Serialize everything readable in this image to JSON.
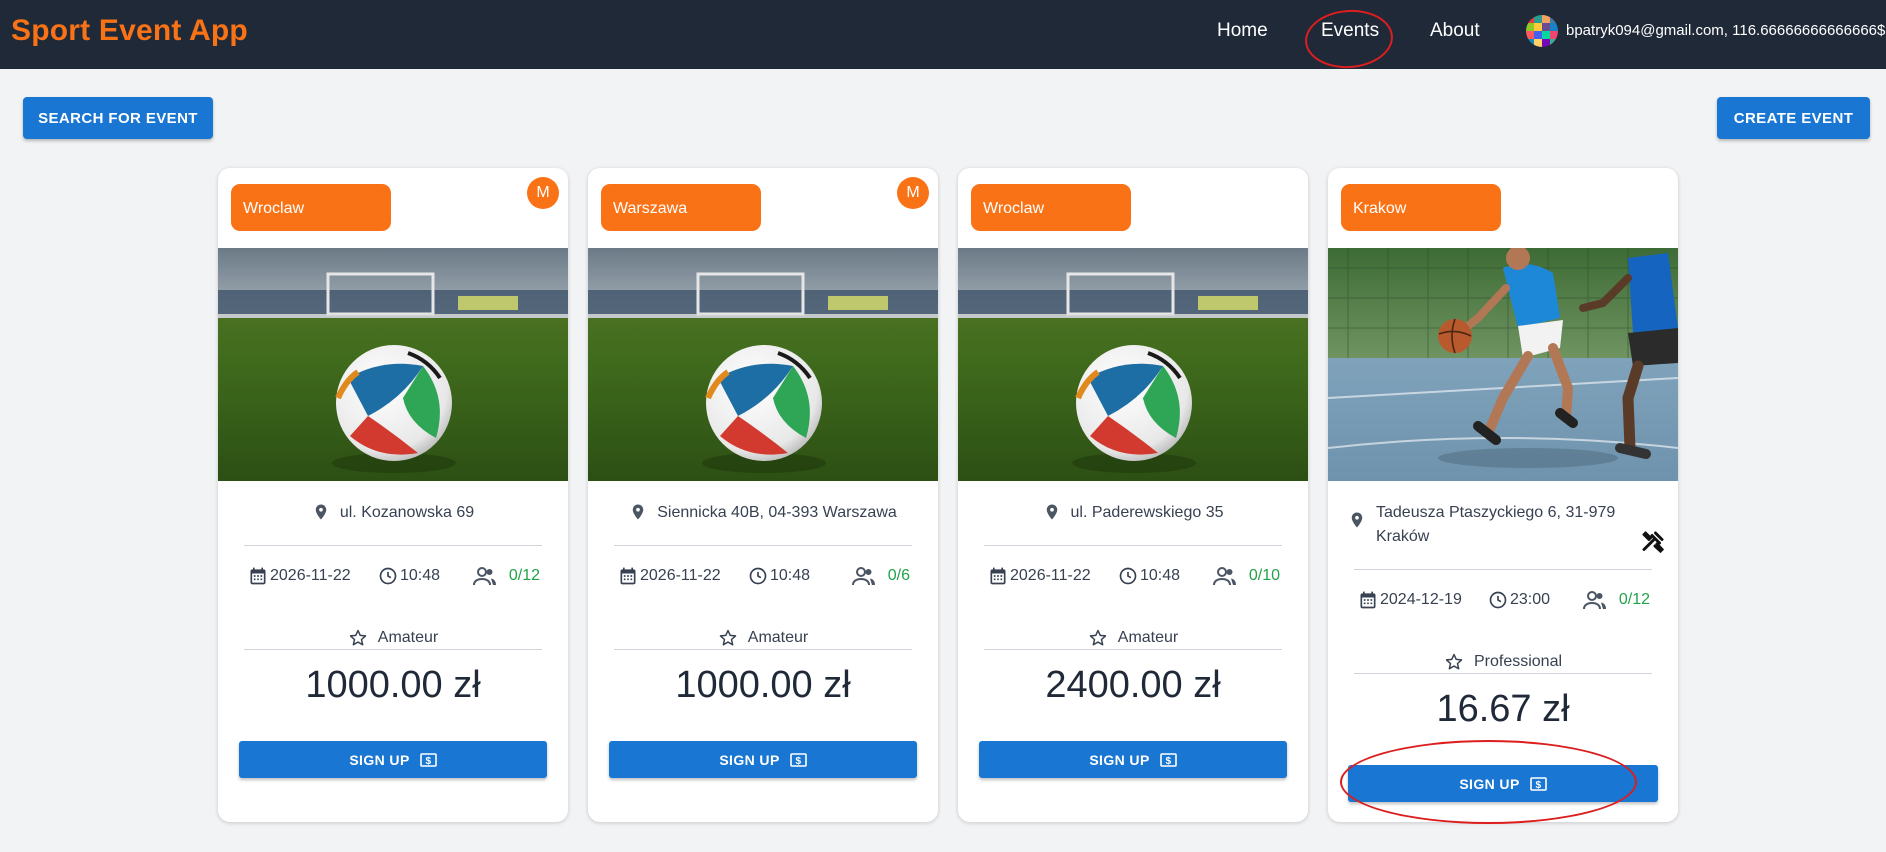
{
  "nav": {
    "brand": "Sport Event App",
    "links": [
      "Home",
      "Events",
      "About"
    ],
    "user": "bpatryk094@gmail.com, 116.66666666666666$"
  },
  "actions": {
    "search_label": "SEARCH FOR EVENT",
    "create_label": "CREATE EVENT"
  },
  "colors": {
    "navbar": "#1f2937",
    "brand": "#f97316",
    "primary": "#1976d2",
    "chip": "#f97316",
    "participants": "#22a24a",
    "annotation": "#dc1e1e"
  },
  "events": [
    {
      "city": "Wroclaw",
      "badge": "M",
      "image": "soccer-ball-on-pitch",
      "address": "ul. Kozanowska 69",
      "date": "2026-11-22",
      "time": "10:48",
      "participants": "0/12",
      "level": "Amateur",
      "price": "1000.00 zł",
      "signup": "SIGN UP"
    },
    {
      "city": "Warszawa",
      "badge": "M",
      "image": "soccer-ball-on-pitch",
      "address": "Siennicka 40B, 04-393 Warszawa",
      "date": "2026-11-22",
      "time": "10:48",
      "participants": "0/6",
      "level": "Amateur",
      "price": "1000.00 zł",
      "signup": "SIGN UP"
    },
    {
      "city": "Wroclaw",
      "badge": "",
      "image": "soccer-ball-on-pitch",
      "address": "ul. Paderewskiego 35",
      "date": "2026-11-22",
      "time": "10:48",
      "participants": "0/10",
      "level": "Amateur",
      "price": "2400.00 zł",
      "signup": "SIGN UP"
    },
    {
      "city": "Krakow",
      "badge": "",
      "image": "basketball-players-court",
      "address": "Tadeusza Ptaszyckiego 6, 31-979 Kraków",
      "date": "2024-12-19",
      "time": "23:00",
      "participants": "0/12",
      "level": "Professional",
      "price": "16.67 zł",
      "signup": "SIGN UP",
      "has_tools_icon": true
    }
  ],
  "icons": [
    "location-pin-icon",
    "calendar-icon",
    "clock-icon",
    "people-icon",
    "star-icon",
    "dollar-icon",
    "tools-icon"
  ]
}
